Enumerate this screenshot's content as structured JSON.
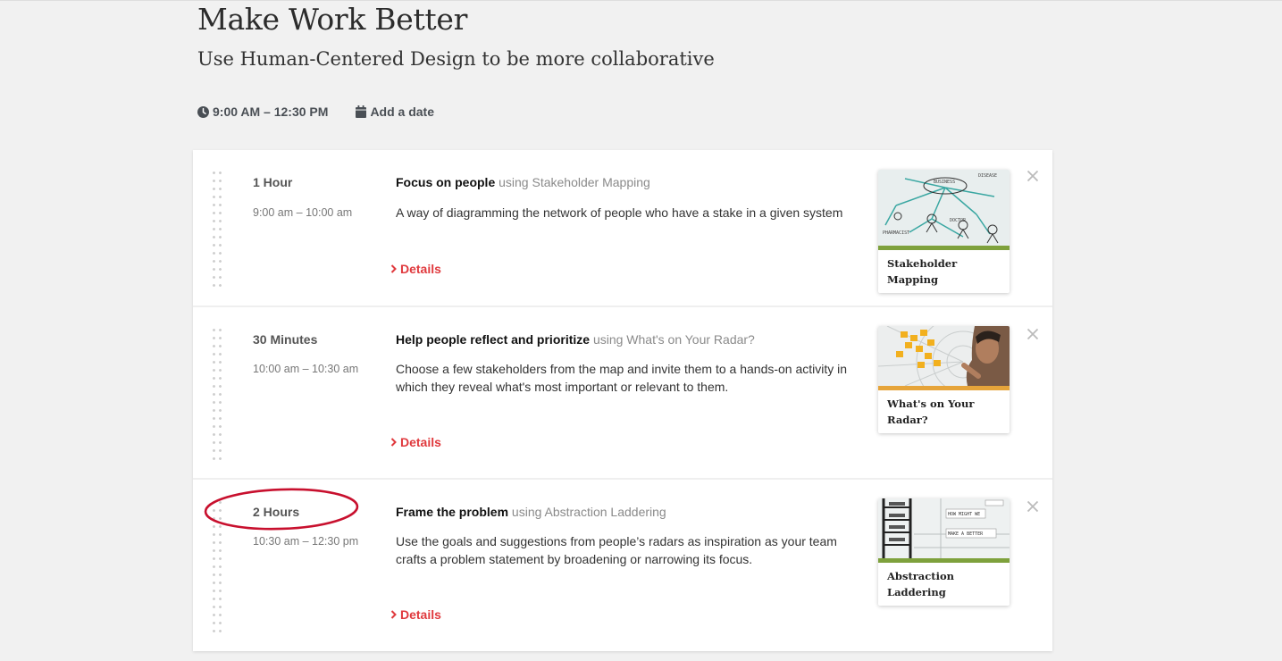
{
  "header": {
    "title": "Make Work Better",
    "subtitle": "Use Human-Centered Design to be more collaborative",
    "time_range": "9:00 AM – 12:30 PM",
    "add_date_label": "Add a date"
  },
  "activities": [
    {
      "duration": "1 Hour",
      "time_range": "9:00 am – 10:00 am",
      "goal": "Focus on people",
      "using_text": "using Stakeholder Mapping",
      "description": "A way of diagramming the network of people who have a stake in a given system",
      "details_label": "Details",
      "card_label": "Stakeholder Mapping",
      "card_band_color": "#7ea13c"
    },
    {
      "duration": "30 Minutes",
      "time_range": "10:00 am – 10:30 am",
      "goal": "Help people reflect and prioritize",
      "using_text": "using What's on Your Radar?",
      "description": "Choose a few stakeholders from the map and invite them to a hands-on activity in which they reveal what's most important or relevant to them.",
      "details_label": "Details",
      "card_label": "What's on Your Radar?",
      "card_band_color": "#e6a43a"
    },
    {
      "duration": "2 Hours",
      "time_range": "10:30 am – 12:30 pm",
      "goal": "Frame the problem",
      "using_text": "using Abstraction Laddering",
      "description": "Use the goals and suggestions from people’s radars as inspiration as your team crafts a problem statement by broadening or narrowing its focus.",
      "details_label": "Details",
      "card_label": "Abstraction Laddering",
      "card_band_color": "#7ea13c"
    }
  ],
  "colors": {
    "accent_red": "#e03a3e",
    "highlight_ellipse": "#c8102e",
    "background": "#f1f1f1"
  },
  "icons": [
    "clock-icon",
    "calendar-icon",
    "drag-handle-icon",
    "chevron-right-icon",
    "close-icon"
  ]
}
